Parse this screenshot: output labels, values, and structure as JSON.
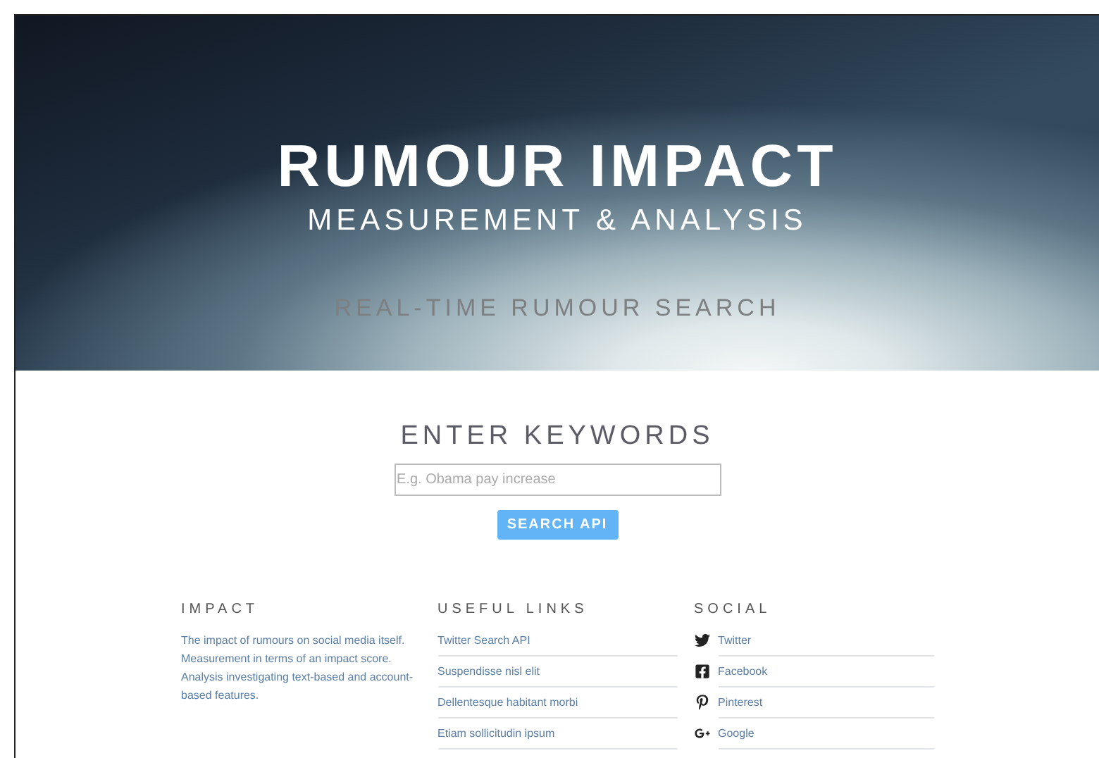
{
  "hero": {
    "title": "RUMOUR IMPACT",
    "subtitle": "MEASUREMENT & ANALYSIS",
    "tagline": "REAL-TIME RUMOUR SEARCH"
  },
  "search": {
    "heading": "ENTER KEYWORDS",
    "placeholder": "E.g. Obama pay increase",
    "button": "SEARCH API"
  },
  "footer": {
    "impact": {
      "heading": "IMPACT",
      "text": "The impact of rumours on social media itself. Measurement in terms of an impact score. Analysis investigating text-based and account-based features."
    },
    "useful_links": {
      "heading": "USEFUL LINKS",
      "items": [
        "Twitter Search API",
        "Suspendisse nisl elit",
        "Dellentesque habitant morbi",
        "Etiam sollicitudin ipsum"
      ]
    },
    "social": {
      "heading": "SOCIAL",
      "items": [
        {
          "kind": "twitter",
          "label": "Twitter"
        },
        {
          "kind": "facebook",
          "label": "Facebook"
        },
        {
          "kind": "pinterest",
          "label": "Pinterest"
        },
        {
          "kind": "google",
          "label": "Google"
        }
      ]
    }
  }
}
